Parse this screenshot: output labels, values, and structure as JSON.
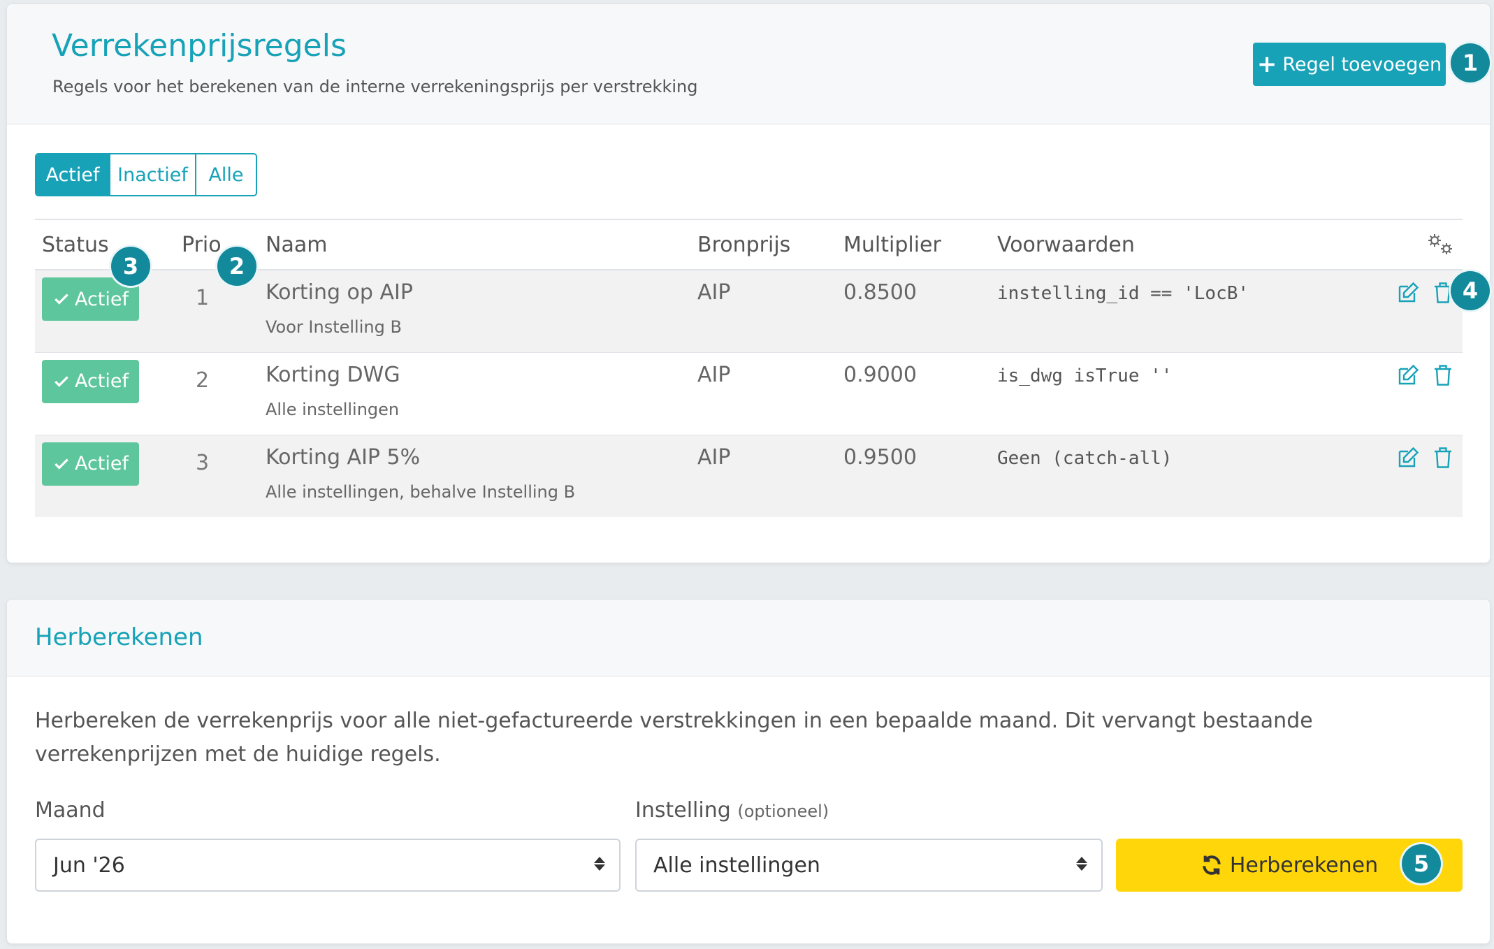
{
  "rules_card": {
    "title": "Verrekenprijsregels",
    "subtitle": "Regels voor het berekenen van de interne verrekeningsprijs per verstrekking",
    "add_button": "Regel toevoegen",
    "filters": [
      "Actief",
      "Inactief",
      "Alle"
    ],
    "active_filter": "Actief",
    "columns": [
      "Status",
      "Prio",
      "Naam",
      "Bronprijs",
      "Multiplier",
      "Voorwaarden"
    ],
    "settings_icon": "gears-icon",
    "rows": [
      {
        "status": "Actief",
        "prio": "1",
        "name": "Korting op AIP",
        "scope": "Voor Instelling B",
        "source": "AIP",
        "multiplier": "0.8500",
        "condition": "instelling_id == 'LocB'"
      },
      {
        "status": "Actief",
        "prio": "2",
        "name": "Korting DWG",
        "scope": "Alle instellingen",
        "source": "AIP",
        "multiplier": "0.9000",
        "condition": "is_dwg isTrue ''"
      },
      {
        "status": "Actief",
        "prio": "3",
        "name": "Korting AIP 5%",
        "scope": "Alle instellingen, behalve Instelling B",
        "source": "AIP",
        "multiplier": "0.9500",
        "condition": "Geen (catch-all)"
      }
    ]
  },
  "recalc_card": {
    "title": "Herberekenen",
    "description": "Herbereken de verrekenprijs voor alle niet-gefactureerde verstrekkingen in een bepaalde maand. Dit vervangt bestaande verrekenprijzen met de huidige regels.",
    "month_label": "Maand",
    "month_value": "Jun '26",
    "institution_label": "Instelling",
    "institution_optional": "(optioneel)",
    "institution_value": "Alle instellingen",
    "button": "Herberekenen"
  },
  "callouts": [
    "1",
    "2",
    "3",
    "4",
    "5"
  ],
  "colors": {
    "accent": "#17a2b8",
    "success": "#5ec69d",
    "warning": "#ffd60a",
    "callout": "#138a9c"
  }
}
